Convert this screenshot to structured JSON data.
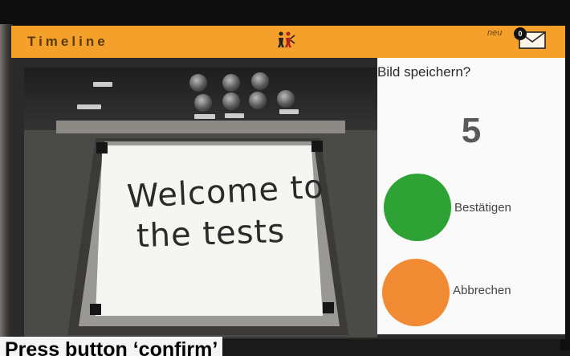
{
  "header": {
    "title": "Timeline",
    "logo_icon": "team-logo-icon",
    "neu_label": "neu",
    "message_count": "0",
    "mail_icon": "envelope-icon",
    "accent_color": "#f5a02a"
  },
  "photo": {
    "handwriting_line1": "Welcome to",
    "handwriting_line2": "the tests"
  },
  "dialog": {
    "prompt": "Bild speichern?",
    "countdown": "5",
    "confirm_label": "Bestätigen",
    "confirm_color": "#2fa236",
    "cancel_label": "Abbrechen",
    "cancel_color": "#f08a33"
  },
  "caption": {
    "text": "Press button ‘confirm’"
  }
}
